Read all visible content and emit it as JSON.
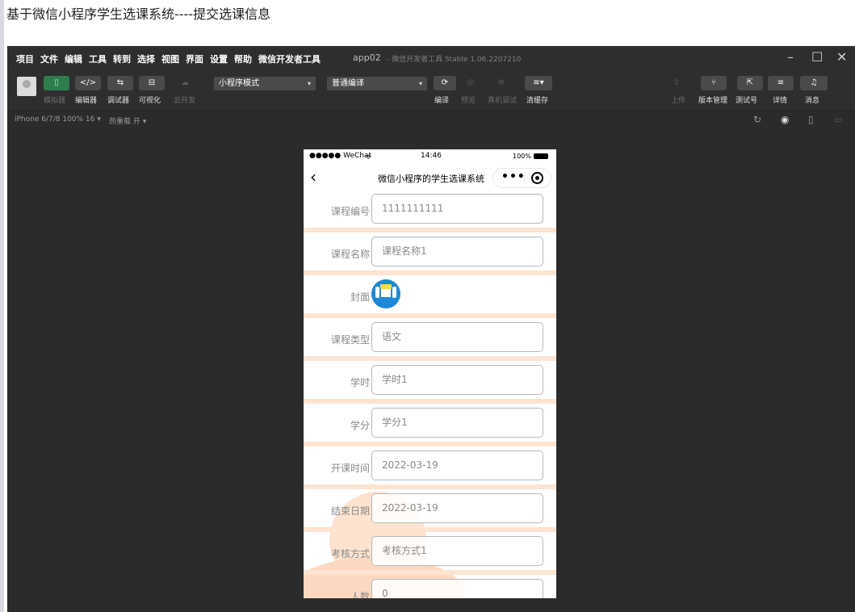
{
  "page": {
    "title": "基于微信小程序学生选课系统----提交选课信息"
  },
  "menubar": {
    "items": [
      "项目",
      "文件",
      "编辑",
      "工具",
      "转到",
      "选择",
      "视图",
      "界面",
      "设置",
      "帮助",
      "微信开发者工具"
    ],
    "app_name": "app02",
    "app_subtitle": "- 微信开发者工具 Stable 1.06.2207210",
    "window_controls": {
      "minimize": "–",
      "maximize": "☐",
      "close": "✕"
    }
  },
  "toolbar": {
    "left_buttons": [
      {
        "icon": "phone-icon",
        "glyph": "▯",
        "label": "模拟器"
      },
      {
        "icon": "code-icon",
        "glyph": "</>",
        "label": "编辑器"
      },
      {
        "icon": "debug-icon",
        "glyph": "⇆",
        "label": "调试器"
      },
      {
        "icon": "visual-icon",
        "glyph": "⊟",
        "label": "可视化"
      },
      {
        "icon": "cloud-icon",
        "glyph": "☁",
        "label": "云开发"
      }
    ],
    "mode_select": "小程序模式",
    "compile_select": "普通编译",
    "center_buttons": [
      {
        "icon": "refresh-icon",
        "glyph": "⟳",
        "label": "编译"
      },
      {
        "icon": "eye-icon",
        "glyph": "◎",
        "label": "预览"
      },
      {
        "icon": "bug-icon",
        "glyph": "✲",
        "label": "真机调试"
      },
      {
        "icon": "layers-icon",
        "glyph": "≋▾",
        "label": "清缓存"
      }
    ],
    "right_buttons": [
      {
        "icon": "upload-icon",
        "glyph": "⇪",
        "label": "上传"
      },
      {
        "icon": "branch-icon",
        "glyph": "⑂",
        "label": "版本管理"
      },
      {
        "icon": "share-icon",
        "glyph": "⇱",
        "label": "测试号"
      },
      {
        "icon": "menu-icon",
        "glyph": "≡",
        "label": "详情"
      },
      {
        "icon": "bell-icon",
        "glyph": "🔔",
        "label": "消息"
      }
    ]
  },
  "statusbar": {
    "device": "iPhone 6/7/8 100% 16 ▾",
    "hot_reload": "热重载 开 ▾"
  },
  "phone": {
    "status": {
      "carrier": "●●●●● WeChat",
      "wifi": "ᯤ",
      "time": "14:46",
      "battery": "100%"
    },
    "nav": {
      "back": "‹",
      "title": "微信小程序的学生选课系统",
      "dots": "•••"
    },
    "form": {
      "course_id": {
        "label": "课程编号",
        "value": "1111111111"
      },
      "course_name": {
        "label": "课程名称",
        "value": "课程名称1"
      },
      "cover": {
        "label": "封面"
      },
      "course_type": {
        "label": "课程类型",
        "value": "语文"
      },
      "hours": {
        "label": "学时",
        "value": "学时1"
      },
      "credits": {
        "label": "学分",
        "value": "学分1"
      },
      "start_date": {
        "label": "开课时间",
        "value": "2022-03-19"
      },
      "end_date": {
        "label": "结束日期",
        "value": "2022-03-19"
      },
      "assessment": {
        "label": "考核方式",
        "value": "考核方式1"
      },
      "next": {
        "label": "人数",
        "value": "0"
      }
    }
  }
}
